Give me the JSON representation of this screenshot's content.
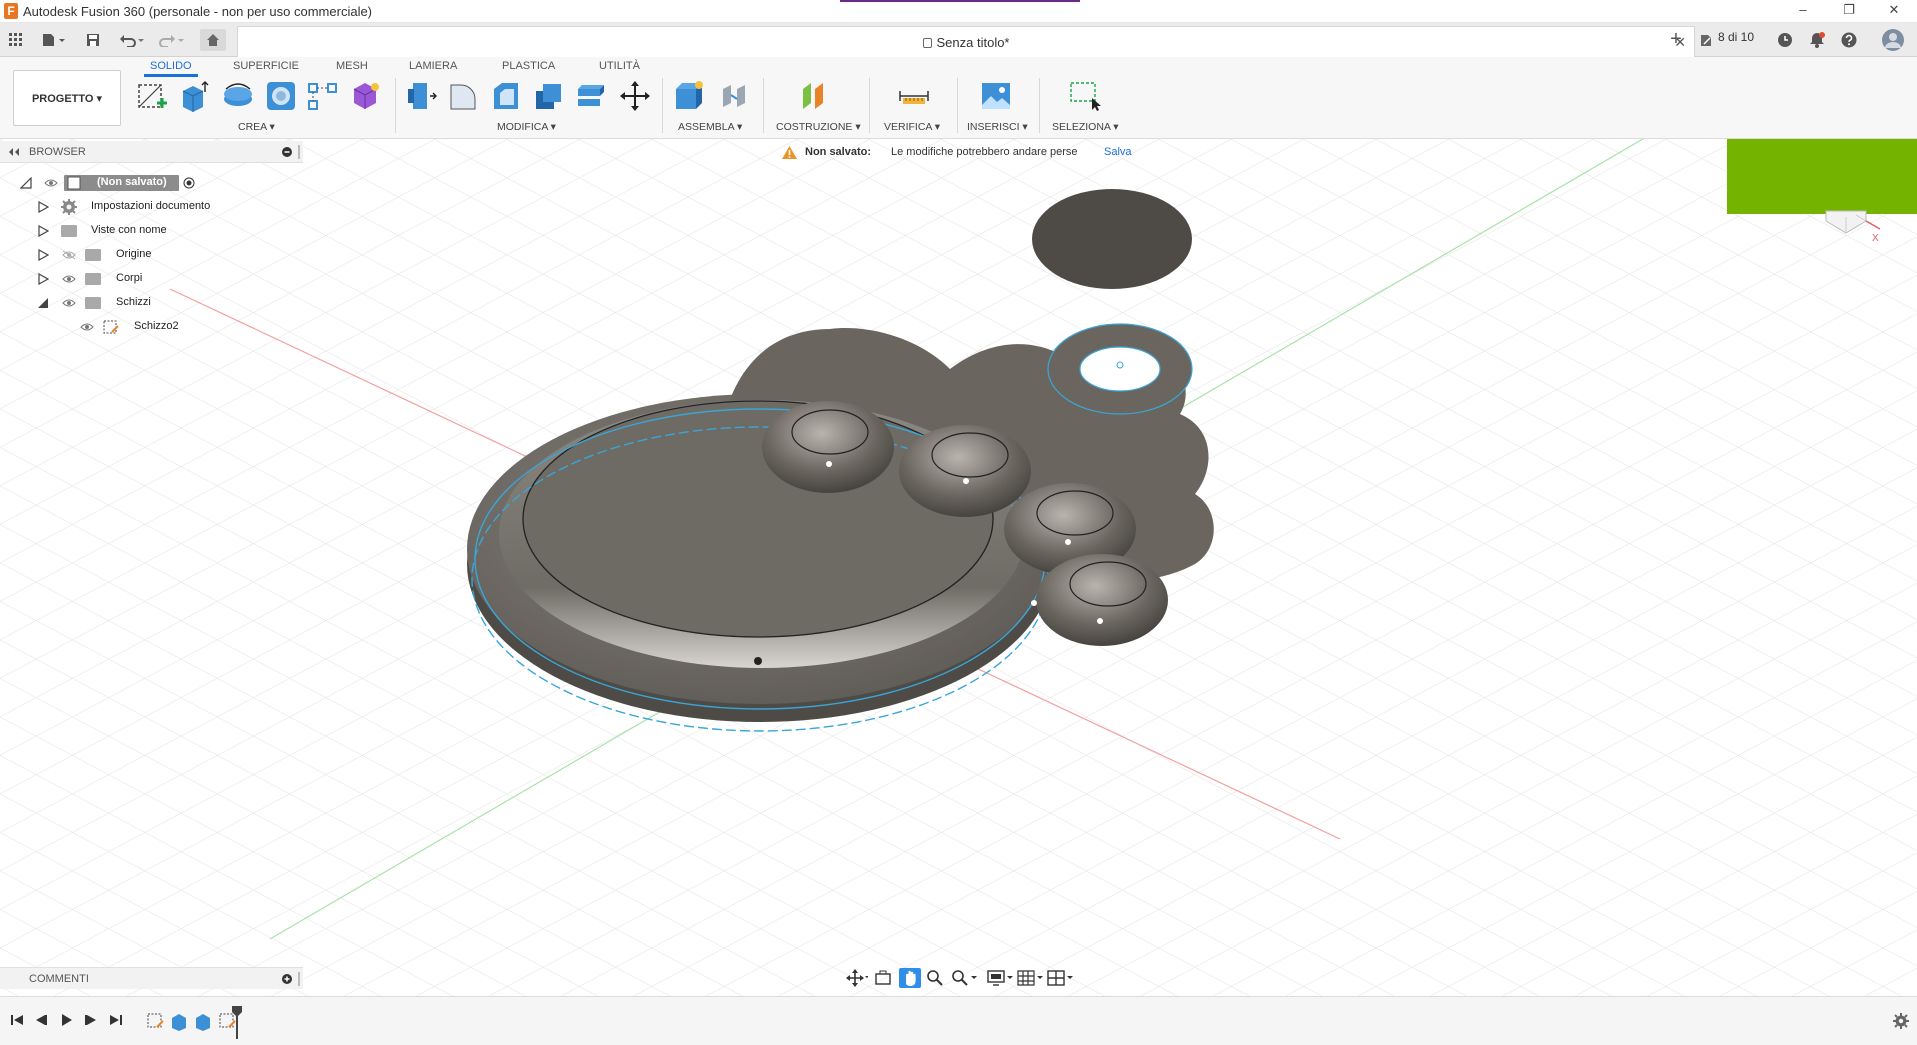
{
  "window": {
    "title": "Autodesk Fusion 360 (personale - non per uso commerciale)",
    "app_icon": "F",
    "minimize": "–",
    "restore": "❐",
    "close": "✕"
  },
  "tabbar": {
    "document_title": "Senza titolo*",
    "close_tab": "✕",
    "new_tab": "+",
    "job_count": "8 di 10"
  },
  "ribbon": {
    "tabs": [
      "SOLIDO",
      "SUPERFICIE",
      "MESH",
      "LAMIERA",
      "PLASTICA",
      "UTILITÀ"
    ],
    "active_tab": "SOLIDO",
    "project_button": "PROGETTO ▾",
    "groups": {
      "crea": "CREA ▾",
      "modifica": "MODIFICA ▾",
      "assembla": "ASSEMBLA ▾",
      "costruzione": "COSTRUZIONE ▾",
      "verifica": "VERIFICA ▾",
      "inserisci": "INSERISCI ▾",
      "seleziona": "SELEZIONA ▾"
    }
  },
  "browser": {
    "header": "BROWSER",
    "items": [
      {
        "label": "(Non salvato)",
        "level": 0,
        "expanded": true
      },
      {
        "label": "Impostazioni documento",
        "level": 1,
        "expanded": false
      },
      {
        "label": "Viste con nome",
        "level": 1,
        "expanded": false
      },
      {
        "label": "Origine",
        "level": 1,
        "expanded": false,
        "hidden": true
      },
      {
        "label": "Corpi",
        "level": 1,
        "expanded": false
      },
      {
        "label": "Schizzi",
        "level": 1,
        "expanded": true
      },
      {
        "label": "Schizzo2",
        "level": 2
      }
    ]
  },
  "unsaved_notice": {
    "title": "Non salvato:",
    "message": "Le modifiche potrebbero andare perse",
    "action": "Salva"
  },
  "comments": {
    "header": "COMMENTI"
  },
  "colors": {
    "accent": "#1b6fd8",
    "nav_cube_overlay": "#74b300",
    "body": "#6e6a64",
    "sketch_line": "#3aa6d8",
    "x_axis": "#e06060",
    "y_axis": "#6bcf6b"
  }
}
